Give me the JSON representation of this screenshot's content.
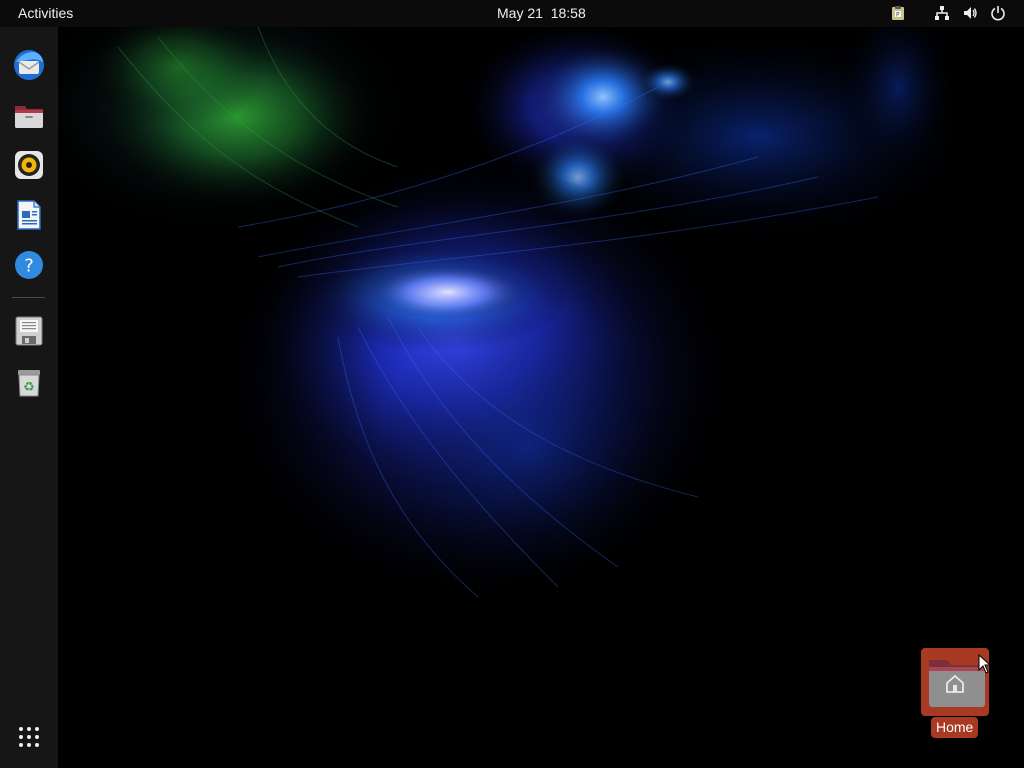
{
  "topbar": {
    "activities_label": "Activities",
    "date": "May 21",
    "time": "18:58",
    "tray_icons": [
      "clipboard-indicator-icon",
      "network-icon",
      "volume-icon",
      "power-icon"
    ]
  },
  "dock": {
    "items": [
      {
        "name": "thunderbird-mail-icon",
        "label": "Thunderbird Mail"
      },
      {
        "name": "files-icon",
        "label": "Files"
      },
      {
        "name": "rhythmbox-icon",
        "label": "Rhythmbox"
      },
      {
        "name": "libreoffice-writer-icon",
        "label": "LibreOffice Writer"
      },
      {
        "name": "help-icon",
        "label": "Help"
      },
      {
        "name": "save-disk-icon",
        "label": "Save"
      },
      {
        "name": "trash-icon",
        "label": "Trash"
      }
    ],
    "show_apps_icon": "show-applications-grid-icon"
  },
  "desktop": {
    "home_icon": {
      "label": "Home",
      "icon": "home-folder-icon",
      "selected": true
    }
  },
  "colors": {
    "topbar_bg": "#0b0b0b",
    "dock_bg": "#161616",
    "selection": "#a83a24",
    "accent_orange": "#e95420"
  }
}
